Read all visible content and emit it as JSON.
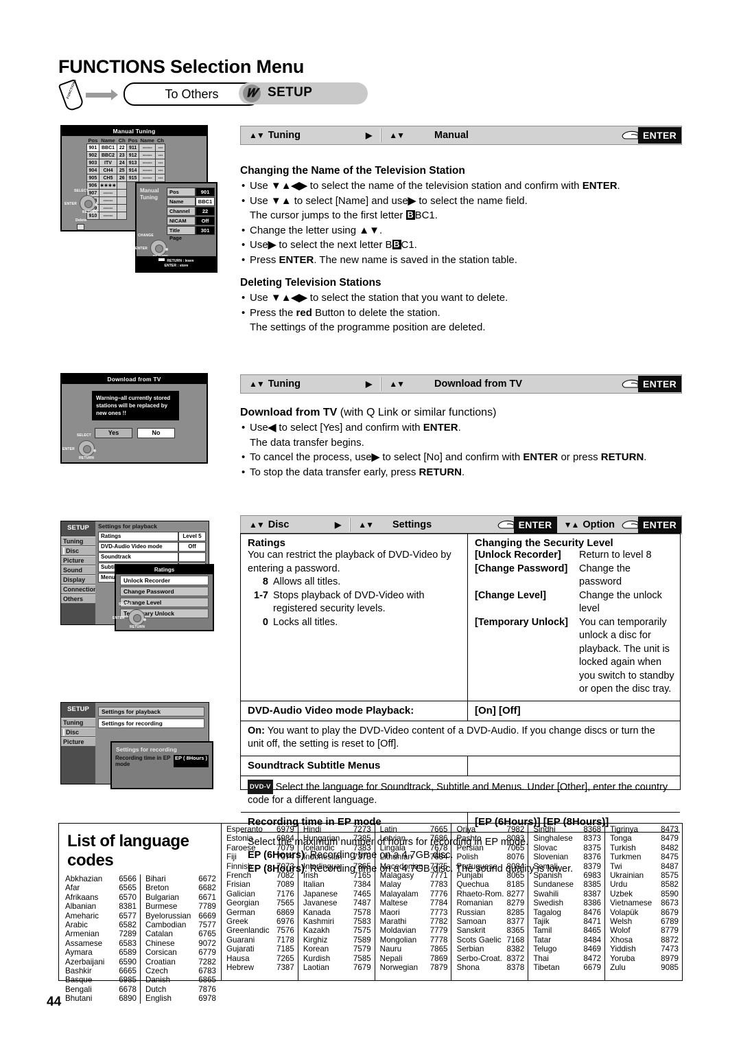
{
  "page": {
    "title": "FUNCTIONS Selection Menu",
    "number": "44"
  },
  "breadcrumb": {
    "functions_button": "FUNCTIONS",
    "step1": "To Others",
    "step2": "SETUP"
  },
  "navbars": {
    "manual": {
      "seg1_arrows": "▲▼",
      "seg1_label": "Tuning",
      "tri": "▶",
      "seg2_arrows": "▲▼",
      "seg2_label": "Manual",
      "enter": "ENTER"
    },
    "download": {
      "seg1_arrows": "▲▼",
      "seg1_label": "Tuning",
      "tri": "▶",
      "seg2_arrows": "▲▼",
      "seg2_label": "Download from TV",
      "enter": "ENTER"
    },
    "disc": {
      "seg1_arrows": "▲▼",
      "seg1_label": "Disc",
      "tri": "▶",
      "seg2_arrows": "▲▼",
      "seg2_label": "Settings",
      "enter1": "ENTER",
      "seg3_arrows": "▼▲",
      "seg3_label": "Option",
      "enter2": "ENTER"
    }
  },
  "sections": {
    "changing_name": {
      "heading": "Changing the Name of the Television Station",
      "b1": "to select the name of the television station and confirm with",
      "b1_use": "Use",
      "b1_arrows": "▼▲◀▶",
      "b1_enter": "ENTER",
      "b2_use": "Use",
      "b2_arrows": "▼▲",
      "b2_mid": "to select [Name] and use",
      "b2_arrow2": "▶",
      "b2_end": "to select the name field.",
      "b2_cont_pre": "The cursor jumps to the first letter",
      "b2_cont_kbd": "B",
      "b2_cont_post": "BC1.",
      "b3": "Change the letter using",
      "b3_arrows": "▲▼",
      "b4_pre": "Use",
      "b4_arrow": "▶",
      "b4_mid": "to select the next letter B",
      "b4_kbd": "B",
      "b4_post": "C1.",
      "b5_pre": "Press",
      "b5_enter": "ENTER",
      "b5_post": ". The new name is saved in the station table."
    },
    "deleting": {
      "heading": "Deleting Television Stations",
      "b1_use": "Use",
      "b1_arrows": "▼▲◀▶",
      "b1_end": "to select the station that you want to delete.",
      "b2_pre": "Press the",
      "b2_red": "red",
      "b2_post": "Button to delete the station.",
      "b2_cont": "The settings of the programme position are deleted."
    },
    "download": {
      "heading_b": "Download from TV",
      "heading_rest": "(with Q Link or similar functions)",
      "b1_use": "Use",
      "b1_arrow": "◀",
      "b1_mid": "to select [Yes] and confirm with",
      "b1_enter": "ENTER",
      "b1_cont": "The data transfer begins.",
      "b2_pre": "To cancel the process, use",
      "b2_arrow": "▶",
      "b2_mid": "to select [No] and confirm with",
      "b2_enter": "ENTER",
      "b2_or": "or press",
      "b2_return": "RETURN",
      "b3_pre": "To stop the data transfer early, press",
      "b3_return": "RETURN"
    }
  },
  "spec": {
    "ratings": {
      "heading": "Ratings",
      "intro": "You can restrict the playback of DVD-Video by entering a password.",
      "levels": [
        {
          "key": "8",
          "text": "Allows all titles."
        },
        {
          "key": "1-7",
          "text": "Stops playback of DVD-Video with registered security levels."
        },
        {
          "key": "0",
          "text": "Locks all titles."
        }
      ]
    },
    "security": {
      "heading": "Changing the Security Level",
      "items": [
        {
          "key": "[Unlock Recorder]",
          "text": "Return to level 8"
        },
        {
          "key": "[Change Password]",
          "text": "Change the password"
        },
        {
          "key": "[Change Level]",
          "text": "Change the unlock level"
        },
        {
          "key": "[Temporary Unlock]",
          "text": "You can temporarily unlock a disc for playback. The unit is locked again when you switch to standby or open the disc tray."
        }
      ]
    },
    "dvd_audio": {
      "label": "DVD-Audio Video mode Playback:",
      "options": "[On] [Off]",
      "on_key": "On:",
      "on_text": "You want to play the DVD-Video content of a DVD-Audio. If you change discs or turn the unit off, the setting is reset to [Off]."
    },
    "soundtrack": {
      "label": "Soundtrack  Subtitle  Menus",
      "badge": "DVD-V",
      "text": "Select the language for Soundtrack, Subtitle and Menus. Under [Other], enter the country code for a different language."
    },
    "ep_mode": {
      "label": "Recording time in EP mode",
      "options": "[EP (6Hours)] [EP (8Hours)]",
      "intro": "Select the maximum number of hours for recording in EP mode.",
      "ep6_key": "EP (6Hours)",
      "ep6_text": ": Recording time on a 4.7GB disc.",
      "ep8_key": "EP (8Hours)",
      "ep8_text": ": Recording time on a 4.7GB disc. The sound quality is lower."
    }
  },
  "osd": {
    "manual_tuning": {
      "title": "Manual Tuning",
      "headers": [
        "Pos",
        "Name",
        "Ch",
        "Pos",
        "Name",
        "Ch"
      ],
      "left_rows": [
        [
          "901",
          "BBC1",
          "22"
        ],
        [
          "902",
          "BBC2",
          "23"
        ],
        [
          "903",
          "ITV",
          "24"
        ],
        [
          "904",
          "CH4",
          "25"
        ],
        [
          "905",
          "CH5",
          "26"
        ],
        [
          "906",
          "∗∗∗∗",
          ""
        ],
        [
          "907",
          "------",
          ""
        ],
        [
          "908",
          "------",
          ""
        ],
        [
          "909",
          "------",
          ""
        ],
        [
          "910",
          "------",
          ""
        ]
      ],
      "right_rows": [
        [
          "911",
          "------",
          "---"
        ],
        [
          "912",
          "------",
          "---"
        ],
        [
          "913",
          "------",
          "---"
        ],
        [
          "914",
          "------",
          "---"
        ],
        [
          "915",
          "------",
          "---"
        ]
      ],
      "select_label": "SELECT",
      "enter_label": "ENTER",
      "return_label": "RETURN",
      "delete_label": "Delete"
    },
    "manual_panel": {
      "side_l1": "Manual",
      "side_l2": "Tuning",
      "fields": [
        {
          "name": "Pos",
          "value": "901"
        },
        {
          "name": "Name",
          "value": "BBC1"
        },
        {
          "name": "Channel",
          "value": "22"
        },
        {
          "name": "NICAM",
          "value": "Off"
        },
        {
          "name": "Title Page",
          "value": "301"
        }
      ],
      "change_label": "CHANGE",
      "enter_label": "ENTER",
      "return_label": "RETURN",
      "footer1": "RETURN : leave",
      "footer2": "ENTER  : store"
    },
    "download_tv": {
      "title": "Download from TV",
      "warning": "Warning–all currently stored stations will be replaced by new ones !!",
      "yes": "Yes",
      "no": "No",
      "select_label": "SELECT",
      "enter_label": "ENTER",
      "return_label": "RETURN"
    },
    "setup_playback": {
      "title": "SETUP",
      "menu": [
        "Tuning",
        "Disc",
        "Picture",
        "Sound",
        "Display",
        "Connection",
        "Others"
      ],
      "caption": "Settings for playback",
      "rows": [
        {
          "name": "Ratings",
          "value": "Level 5"
        },
        {
          "name": "DVD-Audio Video mode Playback",
          "value": "Off"
        },
        {
          "name": "Soundtrack",
          "value": ""
        },
        {
          "name": "Subtitle",
          "value": ""
        },
        {
          "name": "Menus",
          "value": ""
        }
      ],
      "popup_title": "Ratings",
      "popup_items": [
        "Unlock Recorder",
        "Change Password",
        "Change Level",
        "Temporary Unlock"
      ],
      "select_label": "SELECT",
      "enter_label": "ENTER",
      "return_label": "RETURN"
    },
    "setup_recording": {
      "title": "SETUP",
      "menu": [
        "Tuning",
        "Disc",
        "Picture"
      ],
      "item1": "Settings for playback",
      "item2": "Settings for recording",
      "popup_title": "Settings for recording",
      "popup_row_name": "Recording time in EP mode",
      "popup_row_value": "EP ( 8Hours )"
    }
  },
  "languages": {
    "title": "List of language codes",
    "columns": [
      [
        [
          "Abkhazian",
          "6566"
        ],
        [
          "Afar",
          "6565"
        ],
        [
          "Afrikaans",
          "6570"
        ],
        [
          "Albanian",
          "8381"
        ],
        [
          "Ameharic",
          "6577"
        ],
        [
          "Arabic",
          "6582"
        ],
        [
          "Armenian",
          "7289"
        ],
        [
          "Assamese",
          "6583"
        ],
        [
          "Aymara",
          "6589"
        ],
        [
          "Azerbaijani",
          "6590"
        ],
        [
          "Bashkir",
          "6665"
        ],
        [
          "Basque",
          "6985"
        ],
        [
          "Bengali",
          "6678"
        ],
        [
          "Bhutani",
          "6890"
        ]
      ],
      [
        [
          "Bihari",
          "6672"
        ],
        [
          "Breton",
          "6682"
        ],
        [
          "Bulgarian",
          "6671"
        ],
        [
          "Burmese",
          "7789"
        ],
        [
          "Byelorussian",
          "6669"
        ],
        [
          "Cambodian",
          "7577"
        ],
        [
          "Catalan",
          "6765"
        ],
        [
          "Chinese",
          "9072"
        ],
        [
          "Corsican",
          "6779"
        ],
        [
          "Croatian",
          "7282"
        ],
        [
          "Czech",
          "6783"
        ],
        [
          "Danish",
          "6865"
        ],
        [
          "Dutch",
          "7876"
        ],
        [
          "English",
          "6978"
        ]
      ],
      [
        [
          "Esperanto",
          "6979"
        ],
        [
          "Estonia",
          "6984"
        ],
        [
          "Faroese",
          "7079"
        ],
        [
          "Fiji",
          "7074"
        ],
        [
          "Finnish",
          "7073"
        ],
        [
          "French",
          "7082"
        ],
        [
          "Frisian",
          "7089"
        ],
        [
          "Galician",
          "7176"
        ],
        [
          "Georgian",
          "7565"
        ],
        [
          "German",
          "6869"
        ],
        [
          "Greek",
          "6976"
        ],
        [
          "Greenlandic",
          "7576"
        ],
        [
          "Guarani",
          "7178"
        ],
        [
          "Gujarati",
          "7185"
        ],
        [
          "Hausa",
          "7265"
        ],
        [
          "Hebrew",
          "7387"
        ]
      ],
      [
        [
          "Hindi",
          "7273"
        ],
        [
          "Hungarian",
          "7285"
        ],
        [
          "Icelandic",
          "7383"
        ],
        [
          "Indonesian",
          "7378"
        ],
        [
          "Interlingua",
          "7365"
        ],
        [
          "Irish",
          "7165"
        ],
        [
          "Italian",
          "7384"
        ],
        [
          "Japanese",
          "7465"
        ],
        [
          "Javanese",
          "7487"
        ],
        [
          "Kanada",
          "7578"
        ],
        [
          "Kashmiri",
          "7583"
        ],
        [
          "Kazakh",
          "7575"
        ],
        [
          "Kirghiz",
          "7589"
        ],
        [
          "Korean",
          "7579"
        ],
        [
          "Kurdish",
          "7585"
        ],
        [
          "Laotian",
          "7679"
        ]
      ],
      [
        [
          "Latin",
          "7665"
        ],
        [
          "Latvian",
          "7686"
        ],
        [
          "Lingala",
          "7678"
        ],
        [
          "Lithunian",
          "7684"
        ],
        [
          "Macedonian",
          "7775"
        ],
        [
          "Malagasy",
          "7771"
        ],
        [
          "Malay",
          "7783"
        ],
        [
          "Malayalam",
          "7776"
        ],
        [
          "Maltese",
          "7784"
        ],
        [
          "Maori",
          "7773"
        ],
        [
          "Marathi",
          "7782"
        ],
        [
          "Moldavian",
          "7779"
        ],
        [
          "Mongolian",
          "7778"
        ],
        [
          "Nauru",
          "7865"
        ],
        [
          "Nepali",
          "7869"
        ],
        [
          "Norwegian",
          "7879"
        ]
      ],
      [
        [
          "Oriya",
          "7982"
        ],
        [
          "Pashto",
          "8083"
        ],
        [
          "Persian",
          "7065"
        ],
        [
          "Polish",
          "8076"
        ],
        [
          "Portuguese",
          "8084"
        ],
        [
          "Punjabi",
          "8065"
        ],
        [
          "Quechua",
          "8185"
        ],
        [
          "Rhaeto-Rom.",
          "8277"
        ],
        [
          "Romanian",
          "8279"
        ],
        [
          "Russian",
          "8285"
        ],
        [
          "Samoan",
          "8377"
        ],
        [
          "Sanskrit",
          "8365"
        ],
        [
          "Scots Gaelic",
          "7168"
        ],
        [
          "Serbian",
          "8382"
        ],
        [
          "Serbo-Croat.",
          "8372"
        ],
        [
          "Shona",
          "8378"
        ]
      ],
      [
        [
          "Sindhi",
          "8368"
        ],
        [
          "Singhalese",
          "8373"
        ],
        [
          "Slovac",
          "8375"
        ],
        [
          "Slovenian",
          "8376"
        ],
        [
          "Somali",
          "8379"
        ],
        [
          "Spanish",
          "6983"
        ],
        [
          "Sundanese",
          "8385"
        ],
        [
          "Swahili",
          "8387"
        ],
        [
          "Swedish",
          "8386"
        ],
        [
          "Tagalog",
          "8476"
        ],
        [
          "Tajik",
          "8471"
        ],
        [
          "Tamil",
          "8465"
        ],
        [
          "Tatar",
          "8484"
        ],
        [
          "Telugo",
          "8469"
        ],
        [
          "Thai",
          "8472"
        ],
        [
          "Tibetan",
          "6679"
        ]
      ],
      [
        [
          "Tigrinya",
          "8473"
        ],
        [
          "Tonga",
          "8479"
        ],
        [
          "Turkish",
          "8482"
        ],
        [
          "Turkmen",
          "8475"
        ],
        [
          "Twi",
          "8487"
        ],
        [
          "Ukrainian",
          "8575"
        ],
        [
          "Urdu",
          "8582"
        ],
        [
          "Uzbek",
          "8590"
        ],
        [
          "Vietnamese",
          "8673"
        ],
        [
          "Volapük",
          "8679"
        ],
        [
          "Welsh",
          "6789"
        ],
        [
          "Wolof",
          "8779"
        ],
        [
          "Xhosa",
          "8872"
        ],
        [
          "Yiddish",
          "7473"
        ],
        [
          "Yoruba",
          "8979"
        ],
        [
          "Zulu",
          "9085"
        ]
      ]
    ]
  }
}
